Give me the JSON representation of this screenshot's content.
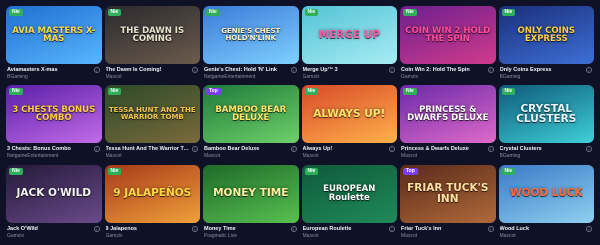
{
  "colors": {
    "page_background": "#0f1226",
    "badge_new": "#2fae5c",
    "badge_top": "#7b3ff2",
    "provider_text": "#8a8ea8"
  },
  "info_icon_glyph": "i",
  "games": [
    {
      "badge": "Nie",
      "badge_type": "new",
      "logo": "AVIA MASTERS X-MAS",
      "title": "Aviamasters X-mas",
      "provider": "BGaming",
      "bg": [
        "#1f6fd0",
        "#58b5ff"
      ],
      "logo_color": "#ffd84a"
    },
    {
      "badge": "Nie",
      "badge_type": "new",
      "logo": "THE DAWN IS COMING",
      "title": "The Dawn Is Coming!",
      "provider": "Mascot",
      "bg": [
        "#2a2a2e",
        "#6b5b4c"
      ],
      "logo_color": "#e9e3d0"
    },
    {
      "badge": "Nie",
      "badge_type": "new",
      "logo": "GENIE'S CHEST HOLD'N'LINK",
      "title": "Genie's Chest: Hold 'N' Link",
      "provider": "NetgameEntertainment",
      "bg": [
        "#3b7ad9",
        "#7fd0ff"
      ],
      "logo_color": "#fff3c4"
    },
    {
      "badge": "Nie",
      "badge_type": "new",
      "logo": "MERGE UP",
      "title": "Merge Up™ 3",
      "provider": "Gamzix",
      "bg": [
        "#54c3d6",
        "#a7ecf3"
      ],
      "logo_color": "#ff5aa8"
    },
    {
      "badge": "Nie",
      "badge_type": "new",
      "logo": "COIN WIN 2 HOLD THE SPIN",
      "title": "Coin Win 2: Hold The Spin",
      "provider": "Gamzix",
      "bg": [
        "#6d1f8e",
        "#d13b8c"
      ],
      "logo_color": "#ff4d9b"
    },
    {
      "badge": "Nie",
      "badge_type": "new",
      "logo": "ONLY COINS EXPRESS",
      "title": "Only Coins Express",
      "provider": "BGaming",
      "bg": [
        "#1a2f7a",
        "#3e6fd6"
      ],
      "logo_color": "#ffcf3e"
    },
    {
      "badge": "Nie",
      "badge_type": "new",
      "logo": "3 CHESTS BONUS COMBO",
      "title": "3 Chests: Bonus Combo",
      "provider": "NetgameEntertainment",
      "bg": [
        "#5a1fa8",
        "#c26be8"
      ],
      "logo_color": "#ffcf3e"
    },
    {
      "badge": "Nie",
      "badge_type": "new",
      "logo": "TESSA HUNT AND THE WARRIOR TOMB",
      "title": "Tessa Hunt And The Warrior Tomb",
      "provider": "Mascot",
      "bg": [
        "#2c4a2a",
        "#7a6a3a"
      ],
      "logo_color": "#f5c54b"
    },
    {
      "badge": "Top",
      "badge_type": "top",
      "logo": "BAMBOO BEAR DELUXE",
      "title": "Bamboo Bear Deluxe",
      "provider": "Mascot",
      "bg": [
        "#1f7a3a",
        "#6fd06a"
      ],
      "logo_color": "#ffe36a"
    },
    {
      "badge": "Nie",
      "badge_type": "new",
      "logo": "ALWAYS UP!",
      "title": "Always Up!",
      "provider": "Mascot",
      "bg": [
        "#d84a2a",
        "#ffb24a"
      ],
      "logo_color": "#ffe36a"
    },
    {
      "badge": "Nie",
      "badge_type": "new",
      "logo": "PRINCESS & DWARFS DELUXE",
      "title": "Princess & Dwarfs Deluxe",
      "provider": "Mascot",
      "bg": [
        "#6a2aa8",
        "#e06acb"
      ],
      "logo_color": "#ffffff"
    },
    {
      "badge": "Nie",
      "badge_type": "new",
      "logo": "CRYSTAL CLUSTERS",
      "title": "Crystal Clusters",
      "provider": "BGaming",
      "bg": [
        "#0e5a7a",
        "#3fd0d8"
      ],
      "logo_color": "#e6fbff"
    },
    {
      "badge": "Nie",
      "badge_type": "new",
      "logo": "JACK O'WILD",
      "title": "Jack O'Wild",
      "provider": "Gamzix",
      "bg": [
        "#241a3a",
        "#6a4a8a"
      ],
      "logo_color": "#f5f5f5"
    },
    {
      "badge": "Nie",
      "badge_type": "new",
      "logo": "9 JALAPEÑOS",
      "title": "9 Jalapenos",
      "provider": "Gamzix",
      "bg": [
        "#a83a1a",
        "#f0a03a"
      ],
      "logo_color": "#ffd84a"
    },
    {
      "badge": "",
      "badge_type": "none",
      "logo": "MONEY TIME",
      "title": "Money Time",
      "provider": "Pragmatic Live",
      "bg": [
        "#1f6a2a",
        "#58c050"
      ],
      "logo_color": "#fff0a0"
    },
    {
      "badge": "Nie",
      "badge_type": "new",
      "logo": "EUROPEAN Roulette",
      "title": "European Roulette",
      "provider": "Mascot",
      "bg": [
        "#0f5a3a",
        "#1f8a5a"
      ],
      "logo_color": "#ffffff"
    },
    {
      "badge": "Top",
      "badge_type": "top",
      "logo": "FRIAR TUCK'S INN",
      "title": "Friar Tuck's Inn",
      "provider": "Mascot",
      "bg": [
        "#5a2a1a",
        "#b06a3a"
      ],
      "logo_color": "#ffe0a0"
    },
    {
      "badge": "Nie",
      "badge_type": "new",
      "logo": "WOOD LUCK",
      "title": "Wood Luck",
      "provider": "Mascot",
      "bg": [
        "#3a7ac8",
        "#8fd0f0"
      ],
      "logo_color": "#ff6a3a"
    }
  ]
}
